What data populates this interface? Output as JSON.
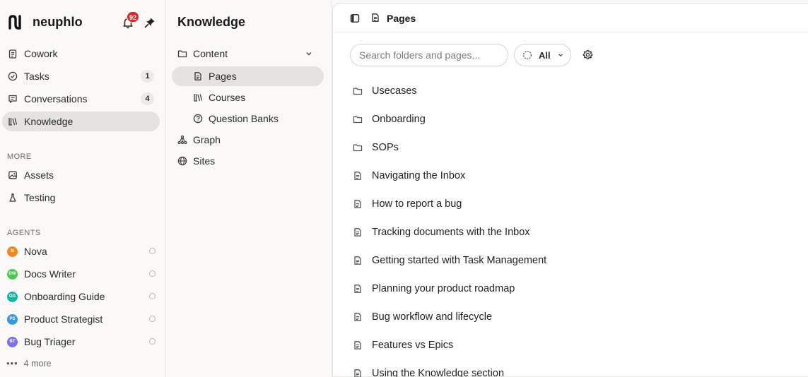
{
  "brand": {
    "name": "neuphlo",
    "notifications_count": "92"
  },
  "sidebar": {
    "nav": [
      {
        "label": "Cowork",
        "icon": "clipboard-icon",
        "count": ""
      },
      {
        "label": "Tasks",
        "icon": "check-circle-icon",
        "count": "1"
      },
      {
        "label": "Conversations",
        "icon": "chat-icon",
        "count": "4"
      },
      {
        "label": "Knowledge",
        "icon": "library-icon",
        "count": "",
        "active": true
      }
    ],
    "more_label": "MORE",
    "more": [
      {
        "label": "Assets",
        "icon": "image-icon"
      },
      {
        "label": "Testing",
        "icon": "flask-icon"
      }
    ],
    "agents_label": "AGENTS",
    "agents": [
      {
        "label": "Nova",
        "initials": "N",
        "color": "#f08a1c"
      },
      {
        "label": "Docs Writer",
        "initials": "DW",
        "color": "#4cc94f"
      },
      {
        "label": "Onboarding Guide",
        "initials": "OG",
        "color": "#14b8a6"
      },
      {
        "label": "Product Strategist",
        "initials": "PS",
        "color": "#2f9be8"
      },
      {
        "label": "Bug Triager",
        "initials": "BT",
        "color": "#7c6ff0"
      }
    ],
    "more_agents": "4 more"
  },
  "knowledge": {
    "title": "Knowledge",
    "content_label": "Content",
    "content_items": [
      {
        "label": "Pages",
        "icon": "document-icon",
        "active": true
      },
      {
        "label": "Courses",
        "icon": "library-icon"
      },
      {
        "label": "Question Banks",
        "icon": "question-circle-icon"
      }
    ],
    "graph_label": "Graph",
    "sites_label": "Sites"
  },
  "main": {
    "title": "Pages",
    "search_placeholder": "Search folders and pages...",
    "filter_label": "All",
    "items": [
      {
        "type": "folder",
        "label": "Usecases"
      },
      {
        "type": "folder",
        "label": "Onboarding"
      },
      {
        "type": "folder",
        "label": "SOPs"
      },
      {
        "type": "page",
        "label": "Navigating the Inbox"
      },
      {
        "type": "page",
        "label": "How to report a bug"
      },
      {
        "type": "page",
        "label": "Tracking documents with the Inbox"
      },
      {
        "type": "page",
        "label": "Getting started with Task Management"
      },
      {
        "type": "page",
        "label": "Planning your product roadmap"
      },
      {
        "type": "page",
        "label": "Bug workflow and lifecycle"
      },
      {
        "type": "page",
        "label": "Features vs Epics"
      },
      {
        "type": "page",
        "label": "Using the Knowledge section"
      }
    ]
  },
  "colors": {
    "badge": "#dc2626",
    "active_bg": "#e4e3e1",
    "page_bg": "#faf9f7"
  }
}
